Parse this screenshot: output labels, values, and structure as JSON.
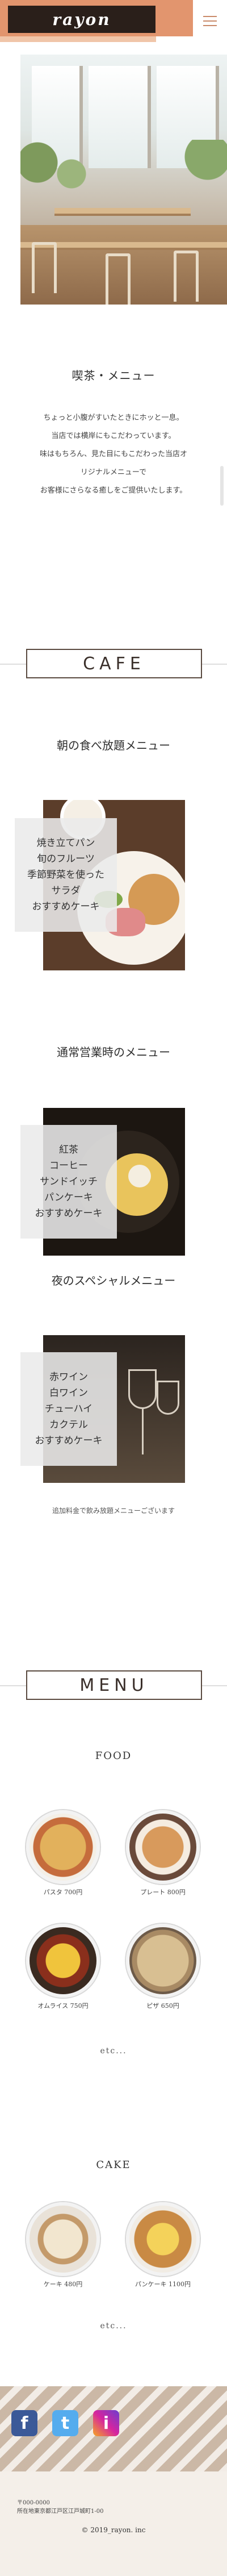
{
  "header": {
    "logo": "rayon"
  },
  "intro": {
    "title": "喫茶・メニュー",
    "lines": [
      "ちょっと小腹がすいたときにホッと一息。",
      "当店では横岸にもこだわっています。",
      "味はもちろん、見た目にもこだわった当店オ",
      "リジナルメニューで",
      "お客様にさらなる癒しをご提供いたします。"
    ]
  },
  "cafe_banner": "CAFE",
  "breakfast": {
    "title": "朝の食べ放題メニュー",
    "items": [
      "焼き立てパン",
      "旬のフルーツ",
      "季節野菜を使った",
      "サラダ",
      "おすすめケーキ"
    ]
  },
  "regular": {
    "title": "通常営業時のメニュー",
    "items": [
      "紅茶",
      "コーヒー",
      "サンドイッチ",
      "パンケーキ",
      "おすすめケーキ"
    ]
  },
  "night": {
    "title": "夜のスペシャルメニュー",
    "items": [
      "赤ワイン",
      "白ワイン",
      "チューハイ",
      "カクテル",
      "おすすめケーキ"
    ],
    "note": "追加料金で飲み放題メニューございます"
  },
  "menu_banner": "MENU",
  "food": {
    "heading": "FOOD",
    "dishes": [
      {
        "caption": "パスタ 700円"
      },
      {
        "caption": "プレート 800円"
      },
      {
        "caption": "オムライス 750円"
      },
      {
        "caption": "ピザ 650円"
      }
    ],
    "etc": "etc..."
  },
  "cake": {
    "heading": "CAKE",
    "dishes": [
      {
        "caption": "ケーキ 480円"
      },
      {
        "caption": "パンケーキ 1100円"
      }
    ],
    "etc": "etc..."
  },
  "footer": {
    "sns": [
      "f",
      "t",
      "i"
    ],
    "address_lines": [
      "〒000-0000",
      "所在地東京都江戸区江戸城町1-00"
    ],
    "copyright": "© 2019_rayon. inc"
  }
}
